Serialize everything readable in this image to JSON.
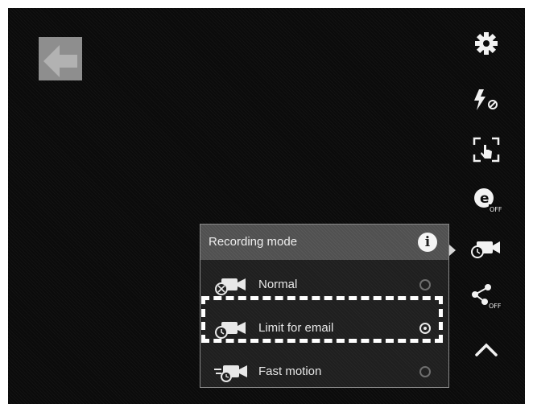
{
  "recording_mode": {
    "title": "Recording mode",
    "info_label": "i",
    "options": [
      {
        "label": "Normal",
        "selected": false,
        "icon": "video-camera-normal-icon"
      },
      {
        "label": "Limit for email",
        "selected": true,
        "icon": "video-camera-email-icon"
      },
      {
        "label": "Fast motion",
        "selected": false,
        "icon": "video-camera-fast-icon"
      }
    ]
  },
  "side_rail": {
    "icons": [
      "gear-icon",
      "flash-off-icon",
      "touch-focus-icon",
      "exposure-off-icon",
      "recording-mode-icon",
      "share-off-icon",
      "collapse-icon"
    ]
  },
  "colors": {
    "background": "#0b0b0b",
    "panel": "#1f1f1f",
    "header": "#505050",
    "text": "#eeeeee"
  }
}
